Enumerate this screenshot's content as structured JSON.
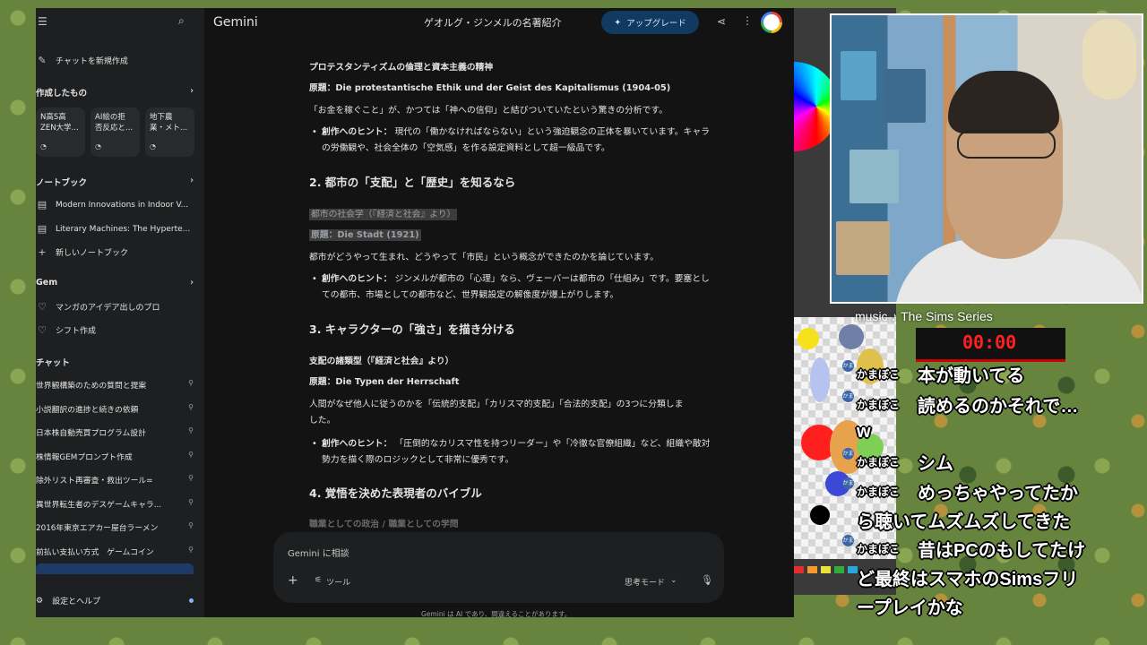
{
  "sidebar": {
    "new_chat": "チャットを新規作成",
    "created_section": "作成したもの",
    "cards": [
      {
        "line1": "N高S高",
        "line2": "ZEN大学..."
      },
      {
        "line1": "AI絵の拒",
        "line2": "否反応と..."
      },
      {
        "line1": "地下農",
        "line2": "業・メト..."
      }
    ],
    "notebook_section": "ノートブック",
    "notebooks": [
      "Modern Innovations in Indoor V...",
      "Literary Machines: The Hyperte...",
      "新しいノートブック"
    ],
    "gem_section": "Gem",
    "gems": [
      "マンガのアイデア出しのプロ",
      "シフト作成"
    ],
    "chat_section": "チャット",
    "chats": [
      "世界観構築のための質問と提案",
      "小説翻訳の進捗と続きの依頼",
      "日本株自動売買プログラム設計",
      "株情報GEMプロンプト作成",
      "除外リスト再審査・救出ツール=",
      "異世界転生者のデスゲームキャラ...",
      "2016年東京エアカー屋台ラーメン",
      "前払い支払い方式　ゲームコイン"
    ],
    "settings": "設定とヘルプ"
  },
  "header": {
    "brand": "Gemini",
    "title": "ゲオルグ・ジンメルの名著紹介",
    "upgrade": "アップグレード"
  },
  "content": {
    "l1": "プロテスタンティズムの倫理と資本主義の精神",
    "l2": "原題：Die protestantische Ethik und der Geist des Kapitalismus (1904-05)",
    "l3": "「お金を稼ぐこと」が、かつては「神への信仰」と結びついていたという驚きの分析です。",
    "hint_label": "創作へのヒント：",
    "b1": "現代の「働かなければならない」という強迫観念の正体を暴いています。キャラの労働観や、社会全体の「空気感」を作る設定資料として超一級品です。",
    "h2": "2. 都市の「支配」と「歴史」を知るなら",
    "l4": "都市の社会学（『経済と社会』より）",
    "l5": "原題：Die Stadt (1921)",
    "l6": "都市がどうやって生まれ、どうやって「市民」という概念ができたのかを論じています。",
    "b2": "ジンメルが都市の「心理」なら、ヴェーバーは都市の「仕組み」です。要塞としての都市、市場としての都市など、世界観設定の解像度が爆上がりします。",
    "h3": "3. キャラクターの「強さ」を描き分ける",
    "l7": "支配の諸類型（『経済と社会』より）",
    "l8": "原題：Die Typen der Herrschaft",
    "l9a": "人間がなぜ他人に従うのかを「伝統的支配」「カリスマ的支配」「合法的支配」の3つに分類しま",
    "l9b": "した。",
    "b3": "「圧倒的なカリスマ性を持つリーダー」や「冷徹な官僚組織」など、組織や敵対勢力を描く際のロジックとして非常に優秀です。",
    "h4": "4. 覚悟を決めた表現者のバイブル",
    "l10": "職業としての政治 / 職業としての学問"
  },
  "input": {
    "placeholder": "Gemini に相談",
    "tools": "ツール",
    "mode": "思考モード",
    "footer": "Gemini は AI であり、間違えることがあります。"
  },
  "overlay": {
    "music": "music ♪ The Sims Series",
    "timer": "00:00",
    "badge": "かま",
    "chat": [
      {
        "name": "かまぼこ",
        "msg": "本が動いてる"
      },
      {
        "name": "かまぼこ",
        "msg": "読めるのかそれで…"
      },
      {
        "name": "",
        "msg": "w"
      },
      {
        "name": "かまぼこ",
        "msg": "シム"
      },
      {
        "name": "かまぼこ",
        "msg": "めっちゃやってたか"
      },
      {
        "name": "",
        "msg": "ら聴いてムズムズしてきた"
      },
      {
        "name": "かまぼこ",
        "msg": "昔はPCのもしてたけ"
      },
      {
        "name": "",
        "msg": "ど最終はスマホのSimsフリ"
      },
      {
        "name": "",
        "msg": "ープレイかな"
      }
    ]
  },
  "colors": {
    "background": "#131314",
    "sidebar": "#1e1f20",
    "upgrade_bg": "#103a5f",
    "timer_red": "#ff2020"
  }
}
